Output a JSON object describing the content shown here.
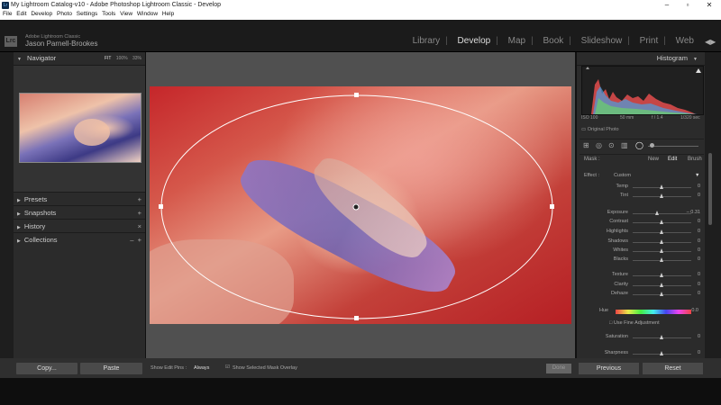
{
  "window": {
    "title": "My Lightroom Catalog-v10 - Adobe Photoshop Lightroom Classic - Develop",
    "controls": {
      "minimize": "–",
      "maximize": "▫",
      "close": "✕"
    }
  },
  "menu": [
    "File",
    "Edit",
    "Develop",
    "Photo",
    "Settings",
    "Tools",
    "View",
    "Window",
    "Help"
  ],
  "identity": {
    "logo": "Lrc",
    "app_name": "Adobe Lightroom Classic",
    "user_name": "Jason Parnell-Brookes"
  },
  "modules": {
    "items": [
      "Library",
      "Develop",
      "Map",
      "Book",
      "Slideshow",
      "Print",
      "Web"
    ],
    "active": "Develop"
  },
  "left_panel": {
    "navigator": {
      "label": "Navigator",
      "zoom_options": [
        "FIT",
        "100%",
        "33%"
      ]
    },
    "sections": [
      "Presets",
      "Snapshots",
      "History",
      "Collections"
    ],
    "copy_label": "Copy...",
    "paste_label": "Paste"
  },
  "toolbar": {
    "show_edit_pins_label": "Show Edit Pins :",
    "show_edit_pins_value": "Always",
    "show_mask_overlay_label": "Show Selected Mask Overlay",
    "done_label": "Done"
  },
  "right_panel": {
    "histogram_label": "Histogram",
    "exif": {
      "iso": "ISO 100",
      "focal": "50 mm",
      "aperture": "f / 1.4",
      "shutter": "1/320 sec"
    },
    "original_photo_label": "Original Photo",
    "mask": {
      "label": "Mask :",
      "new": "New",
      "edit": "Edit",
      "brush": "Brush"
    },
    "effect": {
      "label": "Effect :",
      "value": "Custom"
    },
    "sliders": [
      {
        "name": "Temp",
        "value": "0",
        "pos": 0.5
      },
      {
        "name": "Tint",
        "value": "0",
        "pos": 0.5
      },
      {
        "name": "Exposure",
        "value": "– 0.31",
        "pos": 0.43
      },
      {
        "name": "Contrast",
        "value": "0",
        "pos": 0.5
      },
      {
        "name": "Highlights",
        "value": "0",
        "pos": 0.5
      },
      {
        "name": "Shadows",
        "value": "0",
        "pos": 0.5
      },
      {
        "name": "Whites",
        "value": "0",
        "pos": 0.5
      },
      {
        "name": "Blacks",
        "value": "0",
        "pos": 0.5
      },
      {
        "name": "Texture",
        "value": "0",
        "pos": 0.5
      },
      {
        "name": "Clarity",
        "value": "0",
        "pos": 0.5
      },
      {
        "name": "Dehaze",
        "value": "0",
        "pos": 0.5
      }
    ],
    "hue": {
      "label": "Hue",
      "value": "0.0",
      "fine_adjust": "Use Fine Adjustment"
    },
    "saturation": {
      "name": "Saturation",
      "value": "0",
      "pos": 0.5
    },
    "sharpness": {
      "name": "Sharpness",
      "value": "0",
      "pos": 0.5
    },
    "previous_label": "Previous",
    "reset_label": "Reset"
  },
  "colors": {
    "panel_bg": "#2b2b2b",
    "center_bg": "#505050",
    "mask_outline": "#ffffff"
  }
}
